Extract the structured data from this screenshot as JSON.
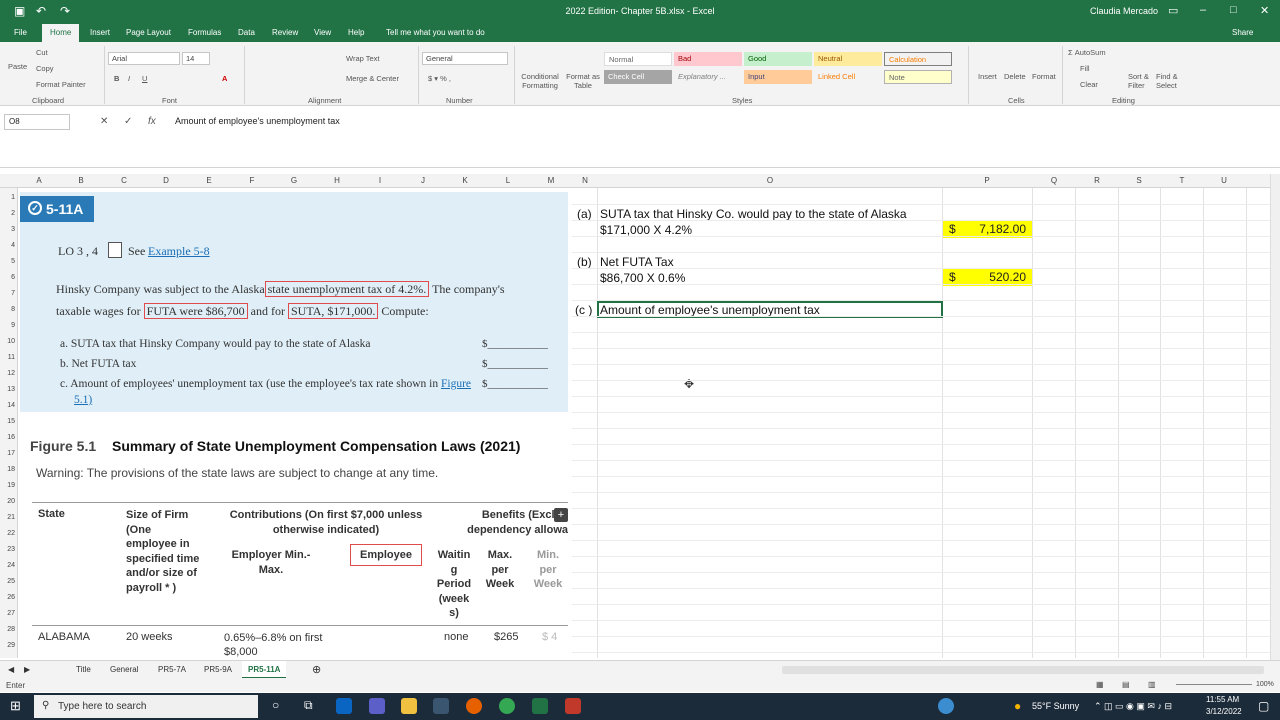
{
  "window": {
    "title": "2022 Edition- Chapter 5B.xlsx - Excel",
    "user": "Claudia Mercado"
  },
  "tabs": [
    "File",
    "Home",
    "Insert",
    "Page Layout",
    "Formulas",
    "Data",
    "Review",
    "View",
    "Help",
    "Tell me what you want to do"
  ],
  "share_label": "Share",
  "ribbon": {
    "clipboard": {
      "paste": "Paste",
      "cut": "Cut",
      "copy": "Copy",
      "format_painter": "Format Painter",
      "label": "Clipboard"
    },
    "font": {
      "name": "Arial",
      "size": "14",
      "label": "Font"
    },
    "alignment": {
      "wrap": "Wrap Text",
      "merge": "Merge & Center",
      "label": "Alignment"
    },
    "number": {
      "format": "General",
      "label": "Number"
    },
    "styles": {
      "conditional": "Conditional Formatting",
      "format_as_table": "Format as Table",
      "cells": [
        "Normal",
        "Bad",
        "Good",
        "Neutral",
        "Calculation",
        "Check Cell",
        "Explanatory ...",
        "Input",
        "Linked Cell",
        "Note"
      ],
      "label": "Styles"
    },
    "cells": {
      "insert": "Insert",
      "delete": "Delete",
      "format": "Format",
      "label": "Cells"
    },
    "editing": {
      "autosum": "AutoSum",
      "fill": "Fill",
      "clear": "Clear",
      "sort": "Sort & Filter",
      "find": "Find & Select",
      "label": "Editing"
    }
  },
  "formula_bar": {
    "name_box": "O8",
    "content": "Amount of employee's unemployment tax"
  },
  "columns": [
    "A",
    "B",
    "C",
    "D",
    "E",
    "F",
    "G",
    "H",
    "I",
    "J",
    "K",
    "L",
    "M",
    "N",
    "O",
    "P",
    "Q",
    "R",
    "S",
    "T",
    "U"
  ],
  "rows": [
    "1",
    "2",
    "3",
    "4",
    "5",
    "6",
    "7",
    "8",
    "9",
    "10",
    "11",
    "12",
    "13",
    "14",
    "15",
    "16",
    "17",
    "18",
    "19",
    "20",
    "21",
    "22",
    "23",
    "24",
    "25",
    "26",
    "27",
    "28",
    "29"
  ],
  "problem": {
    "badge": "5-11A",
    "lo": "LO 3 , 4",
    "see": "See",
    "example_link": "Example 5-8",
    "line1_a": "Hinsky Company was subject to the Alaska",
    "line1_box": "state unemployment tax of 4.2%.",
    "line1_b": "The company's",
    "line2_a": "taxable wages for",
    "line2_box1": "FUTA were $86,700",
    "line2_and": "and for",
    "line2_box2": "SUTA, $171,000.",
    "line2_b": "Compute:",
    "a": "a.  SUTA tax that Hinsky Company would pay to the state of Alaska",
    "b": "b.  Net FUTA tax",
    "c": "c.  Amount of employees' unemployment tax (use the employee's tax rate shown in",
    "c_link": "Figure",
    "c_link2": "5.1)",
    "blank": "$___________"
  },
  "figure": {
    "num": "Figure 5.1",
    "title": "Summary of State Unemployment Compensation Laws (2021)",
    "warning": "Warning: The provisions of the state laws are subject to change at any time.",
    "h_state": "State",
    "h_size": [
      "Size of Firm",
      "(One",
      "employee in",
      "specified time",
      "and/or size of",
      "payroll * )"
    ],
    "h_contrib": [
      "Contributions (On first $7,000 unless",
      "otherwise indicated)"
    ],
    "h_benefits": [
      "Benefits (Exclud",
      "dependency allowa"
    ],
    "h_emp_min": [
      "Employer Min.-",
      "Max."
    ],
    "h_employee": "Employee",
    "h_wait": [
      "Waitin",
      "g",
      "Period",
      "(week",
      "s)"
    ],
    "h_max": [
      "Max.",
      "per",
      "Week"
    ],
    "h_min": [
      "Min.",
      "per",
      "Week"
    ],
    "row_state": "ALABAMA",
    "row_size": "20 weeks",
    "row_rate": [
      "0.65%–6.8% on first",
      "$8,000"
    ],
    "row_wait": "none",
    "row_max": "$265",
    "row_min": "$ 4"
  },
  "sheet": {
    "a_label": "(a)",
    "a_text": "SUTA tax that Hinsky Co. would pay to the state of Alaska",
    "a_calc": "$171,000 X 4.2%",
    "a_dollar": "$",
    "a_value": "7,182.00",
    "b_label": "(b)",
    "b_text": "Net FUTA Tax",
    "b_calc": "$86,700 X 0.6%",
    "b_dollar": "$",
    "b_value": "520.20",
    "c_label": "(c )",
    "c_text": "Amount of employee's unemployment tax"
  },
  "sheet_tabs": [
    "Title",
    "General",
    "PR5-7A",
    "PR5-9A",
    "PR5-11A"
  ],
  "status": "Enter",
  "zoom": "100%",
  "taskbar": {
    "search": "Type here to search",
    "weather": "55°F  Sunny",
    "time": "11:55 AM",
    "date": "3/12/2022"
  }
}
